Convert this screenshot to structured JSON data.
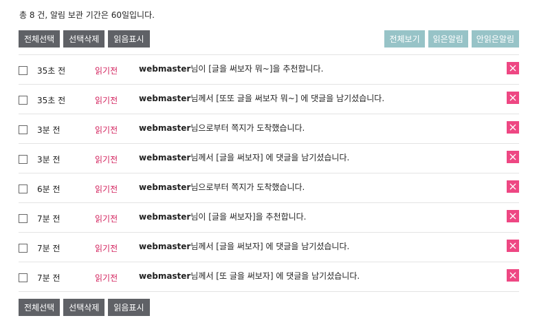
{
  "summary": "총 8 건, 알림 보관 기간은 60일입니다.",
  "actions": {
    "select_all": "전체선택",
    "delete_selected": "선택삭제",
    "mark_read": "읽음표시"
  },
  "filters": {
    "all": "전체보기",
    "read": "읽은알림",
    "unread": "안읽은알림"
  },
  "colors": {
    "dark_button": "#5f6166",
    "filter_button": "#97c3c7",
    "unread_status": "#d3235e",
    "delete_button": "#ee4783"
  },
  "notifications": [
    {
      "time": "35초 전",
      "status": "읽기전",
      "user": "webmaster",
      "text": "님이 [글을 써보자 뭐~]을 추천합니다."
    },
    {
      "time": "35초 전",
      "status": "읽기전",
      "user": "webmaster",
      "text": "님께서 [또또 글을 써보자 뭐~] 에 댓글을 남기셨습니다."
    },
    {
      "time": "3분 전",
      "status": "읽기전",
      "user": "webmaster",
      "text": "님으로부터 쪽지가 도착했습니다."
    },
    {
      "time": "3분 전",
      "status": "읽기전",
      "user": "webmaster",
      "text": "님께서 [글을 써보자] 에 댓글을 남기셨습니다."
    },
    {
      "time": "6분 전",
      "status": "읽기전",
      "user": "webmaster",
      "text": "님으로부터 쪽지가 도착했습니다."
    },
    {
      "time": "7분 전",
      "status": "읽기전",
      "user": "webmaster",
      "text": "님이 [글을 써보자]을 추천합니다."
    },
    {
      "time": "7분 전",
      "status": "읽기전",
      "user": "webmaster",
      "text": "님께서 [글을 써보자] 에 댓글을 남기셨습니다."
    },
    {
      "time": "7분 전",
      "status": "읽기전",
      "user": "webmaster",
      "text": "님께서 [또 글을 써보자] 에 댓글을 남기셨습니다."
    }
  ]
}
